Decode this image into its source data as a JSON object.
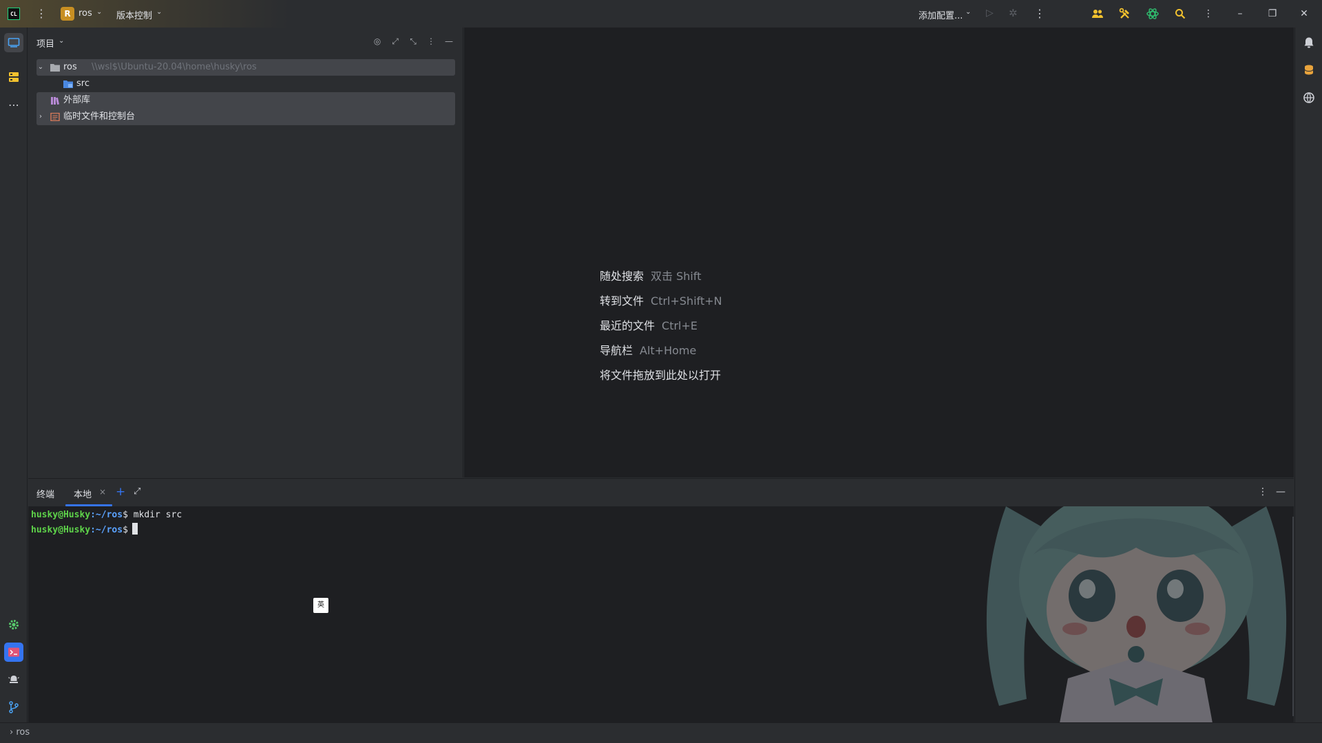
{
  "titlebar": {
    "app_logo": "CL",
    "project_badge": "R",
    "project_name": "ros",
    "vcs_label": "版本控制",
    "add_config_label": "添加配置..."
  },
  "project_panel": {
    "title": "项目",
    "tree": [
      {
        "label": "ros",
        "path": "\\\\wsl$\\Ubuntu-20.04\\home\\husky\\ros",
        "expanded": true,
        "icon": "folder-icon"
      },
      {
        "label": "src",
        "icon": "source-folder-icon"
      },
      {
        "label": "外部库",
        "icon": "library-icon"
      },
      {
        "label": "临时文件和控制台",
        "expanded": false,
        "icon": "scratches-icon"
      }
    ]
  },
  "editor_hints": [
    {
      "label": "随处搜索",
      "key": "双击 Shift"
    },
    {
      "label": "转到文件",
      "key": "Ctrl+Shift+N"
    },
    {
      "label": "最近的文件",
      "key": "Ctrl+E"
    },
    {
      "label": "导航栏",
      "key": "Alt+Home"
    },
    {
      "label": "将文件拖放到此处以打开",
      "key": ""
    }
  ],
  "terminal": {
    "title": "终端",
    "tab_label": "本地",
    "lines": [
      {
        "user": "husky@Husky",
        "path": ":~/ros",
        "prompt": "$",
        "command": " mkdir src"
      },
      {
        "user": "husky@Husky",
        "path": ":~/ros",
        "prompt": "$",
        "command": ""
      }
    ],
    "ime_indicator": "英"
  },
  "statusbar": {
    "breadcrumb": "› ros"
  },
  "colors": {
    "accent": "#3574f0",
    "project_badge": "#c88f22",
    "terminal_user": "#5ed34a",
    "terminal_path": "#5aa2ff"
  }
}
